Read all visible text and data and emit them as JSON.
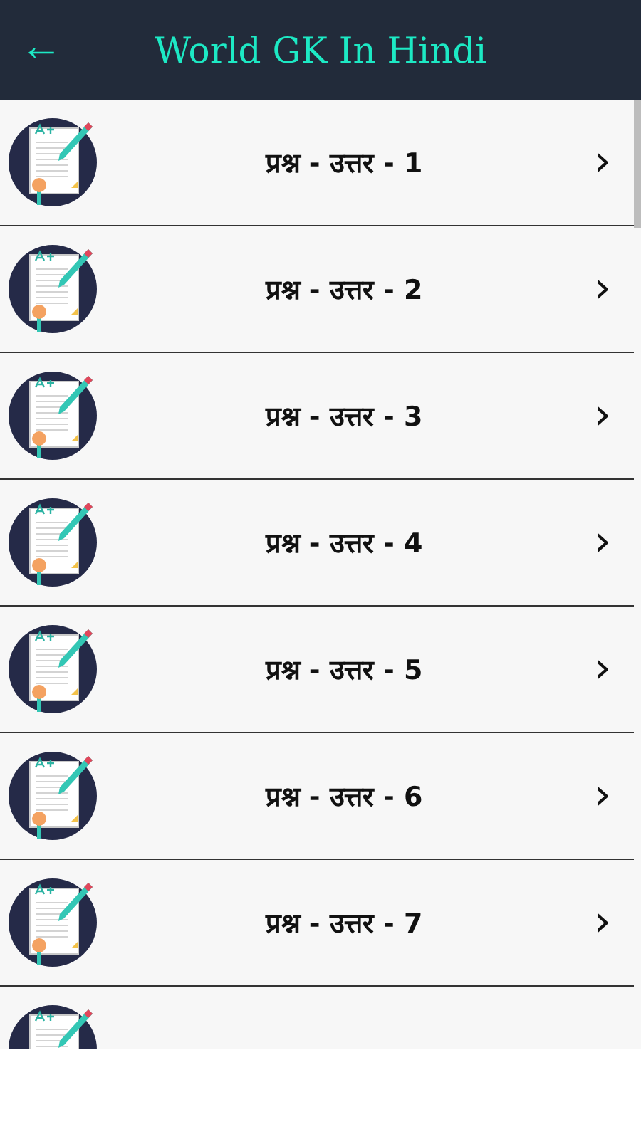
{
  "app_bar": {
    "back": "←",
    "title": "World GK In Hindi"
  },
  "items": [
    {
      "kind": "full",
      "label": "प्रश्न - उत्तर - 1",
      "chevron": "›"
    },
    {
      "kind": "full",
      "label": "प्रश्न - उत्तर - 2",
      "chevron": "›"
    },
    {
      "kind": "full",
      "label": "प्रश्न - उत्तर - 3",
      "chevron": "›"
    },
    {
      "kind": "full",
      "label": "प्रश्न - उत्तर - 4",
      "chevron": "›"
    },
    {
      "kind": "full",
      "label": "प्रश्न - उत्तर - 5",
      "chevron": "›"
    },
    {
      "kind": "full",
      "label": "प्रश्न - उत्तर - 6",
      "chevron": "›"
    },
    {
      "kind": "full",
      "label": "प्रश्न - उत्तर - 7",
      "chevron": "›"
    },
    {
      "kind": "cut"
    }
  ]
}
